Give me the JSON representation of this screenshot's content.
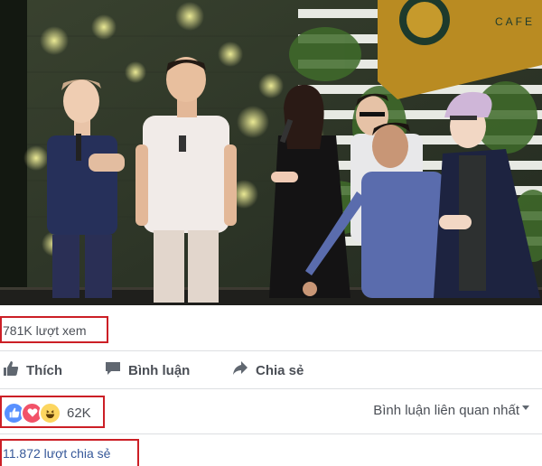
{
  "video": {
    "cafe_sign_letters": "CAFE",
    "people": [
      "singer-left",
      "man-white-shirt",
      "singer-woman",
      "man-glasses",
      "man-dancing",
      "man-right-jacket"
    ]
  },
  "stats": {
    "views": "781K lượt xem"
  },
  "actions": {
    "like": "Thích",
    "comment": "Bình luận",
    "share": "Chia sẻ"
  },
  "reactions": {
    "icons": [
      "like-icon",
      "love-icon",
      "haha-icon"
    ],
    "count": "62K",
    "colors": {
      "like": "#5890ff",
      "love": "#f25268",
      "haha": "#fcd660"
    }
  },
  "comments_sort": {
    "label": "Bình luận liên quan nhất"
  },
  "shares": {
    "text": "11.872 lượt chia sẻ"
  },
  "accent": {
    "highlight": "#cc1f26",
    "link": "#365899"
  }
}
